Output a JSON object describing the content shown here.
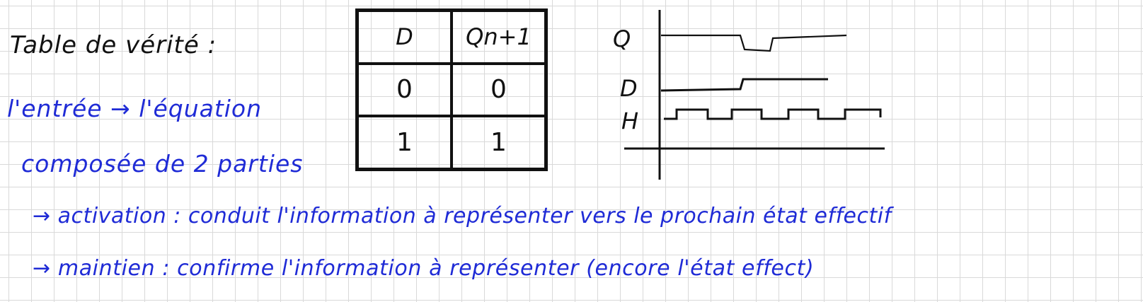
{
  "notes": {
    "title": "Table de vérité :",
    "line1": "l'entrée → l'équation",
    "line2": "composée de 2 parties",
    "line3": "→ activation : conduit l'information à représenter vers le prochain état effectif",
    "line4": "→ maintien : confirme l'information à représenter (encore l'état effect)"
  },
  "truth_table": {
    "headers": [
      "D",
      "Qn+1"
    ],
    "rows": [
      [
        "0",
        "0"
      ],
      [
        "1",
        "1"
      ]
    ]
  },
  "timing_diagram": {
    "signal_labels": [
      "Q",
      "D",
      "H"
    ],
    "waveforms": {
      "H": "square wave with 4 periods",
      "D": "low then rising to high",
      "Q": "high, brief low dip, then high"
    }
  },
  "colors": {
    "ink_black": "#111111",
    "ink_blue": "#1f2bd6",
    "grid": "#d9d9d9"
  }
}
